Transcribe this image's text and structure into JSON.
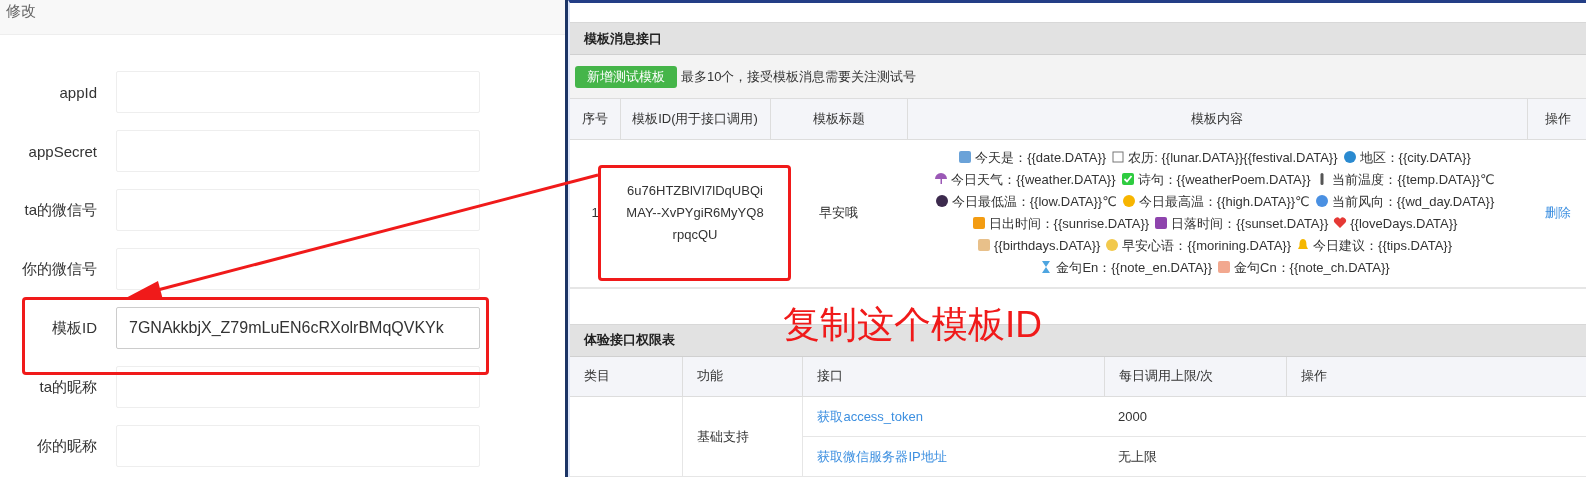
{
  "dialog": {
    "title": "修改",
    "fields": [
      {
        "label": "appId"
      },
      {
        "label": "appSecret"
      },
      {
        "label": "ta的微信号"
      },
      {
        "label": "你的微信号"
      },
      {
        "label": "模板ID",
        "value": "7GNAkkbjX_Z79mLuEN6cRXolrBMqQVKYk"
      },
      {
        "label": "ta的昵称"
      },
      {
        "label": "你的昵称"
      }
    ]
  },
  "template_section": {
    "title": "模板消息接口",
    "add_button": "新增测试模板",
    "note": "最多10个，接受模板消息需要关注测试号",
    "table": {
      "columns": [
        "序号",
        "模板ID(用于接口调用)",
        "模板标题",
        "模板内容",
        "操作"
      ],
      "rows": [
        {
          "index": "1",
          "template_id": "6u76HTZBlVI7lDqUBQiMAY--XvPYgiR6MyYQ8rpqcQU",
          "title": "早安哦",
          "action": "删除",
          "content": [
            {
              "text": "今天是：{{date.DATA}}"
            },
            {
              "text": "农历: {{lunar.DATA}}{{festival.DATA}}"
            },
            {
              "text": "地区：{{city.DATA}}"
            },
            {
              "text": "今日天气：{{weather.DATA}}"
            },
            {
              "text": "诗句：{{weatherPoem.DATA}}"
            },
            {
              "text": "当前温度：{{temp.DATA}}℃"
            },
            {
              "text": "今日最低温：{{low.DATA}}℃"
            },
            {
              "text": "今日最高温：{{high.DATA}}℃"
            },
            {
              "text": "当前风向：{{wd_day.DATA}}"
            },
            {
              "text": "日出时间：{{sunrise.DATA}}"
            },
            {
              "text": "日落时间：{{sunset.DATA}}"
            },
            {
              "text": "{{loveDays.DATA}}"
            },
            {
              "text": "{{birthdays.DATA}}"
            },
            {
              "text": "早安心语：{{morining.DATA}}"
            },
            {
              "text": "今日建议：{{tips.DATA}}"
            },
            {
              "text": "金句En：{{note_en.DATA}}"
            },
            {
              "text": "金句Cn：{{note_ch.DATA}}"
            }
          ]
        }
      ]
    }
  },
  "permission_section": {
    "title": "体验接口权限表",
    "table": {
      "columns": [
        "类目",
        "功能",
        "接口",
        "每日调用上限/次",
        "操作"
      ],
      "rows": [
        {
          "function": "基础支持",
          "interface": "获取access_token",
          "limit": "2000"
        },
        {
          "interface": "获取微信服务器IP地址",
          "limit": "无上限"
        }
      ]
    }
  },
  "annotation": {
    "text": "复制这个模板ID"
  }
}
